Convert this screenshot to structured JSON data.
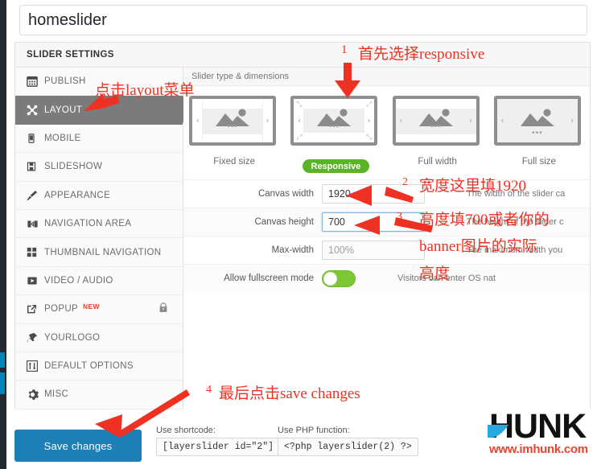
{
  "window": {
    "slider_title": "homeslider"
  },
  "panel": {
    "header": "SLIDER SETTINGS",
    "content_header": "Slider type & dimensions"
  },
  "sidebar": {
    "items": [
      {
        "label": "PUBLISH",
        "icon": "calendar-icon",
        "active": false
      },
      {
        "label": "LAYOUT",
        "icon": "layout-icon",
        "active": true
      },
      {
        "label": "MOBILE",
        "icon": "mobile-icon",
        "active": false
      },
      {
        "label": "SLIDESHOW",
        "icon": "slideshow-icon",
        "active": false
      },
      {
        "label": "APPEARANCE",
        "icon": "brush-icon",
        "active": false
      },
      {
        "label": "NAVIGATION AREA",
        "icon": "navigation-icon",
        "active": false
      },
      {
        "label": "THUMBNAIL NAVIGATION",
        "icon": "grid-icon",
        "active": false
      },
      {
        "label": "VIDEO / AUDIO",
        "icon": "play-icon",
        "active": false
      },
      {
        "label": "POPUP",
        "icon": "external-link-icon",
        "active": false,
        "badge": "NEW",
        "locked": true
      },
      {
        "label": "YOURLOGO",
        "icon": "pin-icon",
        "active": false
      },
      {
        "label": "DEFAULT OPTIONS",
        "icon": "sliders-icon",
        "active": false
      },
      {
        "label": "MISC",
        "icon": "gear-icon",
        "active": false
      }
    ]
  },
  "slider_types": [
    {
      "label": "Fixed size",
      "selected": false
    },
    {
      "label": "Responsive",
      "selected": true
    },
    {
      "label": "Full width",
      "selected": false
    },
    {
      "label": "Full size",
      "selected": false
    }
  ],
  "settings": [
    {
      "label": "Canvas width",
      "value": "1920",
      "placeholder": "",
      "desc": "The width of the slider ca",
      "focused": false
    },
    {
      "label": "Canvas height",
      "value": "700",
      "placeholder": "",
      "desc": "The height of the slider c",
      "focused": true
    },
    {
      "label": "Max-width",
      "value": "",
      "placeholder": "100%",
      "desc": "The maximum width you",
      "focused": false
    },
    {
      "label": "Allow fullscreen mode",
      "value": "",
      "placeholder": "",
      "desc": "Visitors can enter OS nat",
      "toggle": true,
      "toggle_on": true
    }
  ],
  "footer": {
    "save_label": "Save changes",
    "shortcode_label": "Use shortcode:",
    "shortcode_value": "[layerslider id=\"2\"]",
    "php_label": "Use PHP function:",
    "php_value": "<?php layerslider(2) ?>"
  },
  "watermark": {
    "brand": "HUNK",
    "url": "www.imhunk.com"
  },
  "annotations": [
    {
      "id": "a1",
      "num": "1",
      "text": "首先选择responsive"
    },
    {
      "id": "a2",
      "num": "",
      "text": "点击layout菜单"
    },
    {
      "id": "a3",
      "num": "2",
      "text": "宽度这里填1920"
    },
    {
      "id": "a4",
      "num": "3",
      "text": "高度填700或者你的"
    },
    {
      "id": "a5",
      "num": "",
      "text": "banner图片的实际"
    },
    {
      "id": "a6",
      "num": "",
      "text": "高度"
    },
    {
      "id": "a7",
      "num": "4",
      "text": "最后点击save changes"
    }
  ],
  "colors": {
    "accent_blue": "#1c7fb5",
    "green": "#5cb328",
    "annotation_red": "#ef3124",
    "active_gray": "#7b7b7b",
    "new_badge": "#e8432f"
  }
}
